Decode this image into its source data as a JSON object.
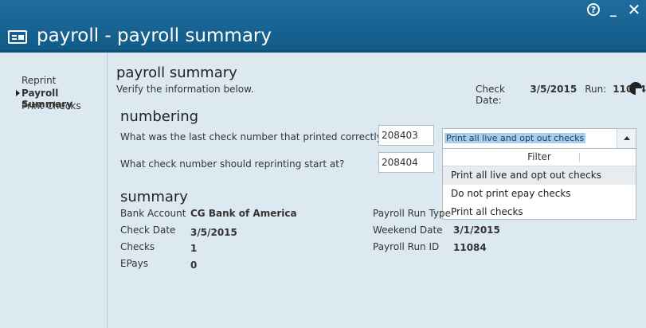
{
  "window": {
    "title": "payroll - payroll summary",
    "controls": {
      "help": "?",
      "minimize": "_",
      "close": "✕"
    }
  },
  "sidebar": {
    "items": [
      {
        "label": "Reprint"
      },
      {
        "label": "Payroll Summary",
        "active": true
      },
      {
        "label": "Print Checks"
      }
    ]
  },
  "main": {
    "title": "payroll summary",
    "subtitle": "Verify the information below.",
    "check_date_label": "Check Date:",
    "check_date_value": "3/5/2015",
    "run_label": "Run:",
    "run_value": "11084"
  },
  "numbering": {
    "heading": "numbering",
    "last_check_question": "What was the last check number that printed correctly?",
    "last_check_value": "208403",
    "reprint_start_question": "What check number should reprinting start at?",
    "reprint_start_value": "208404"
  },
  "print_select": {
    "selected": "Print all live and opt out checks",
    "filter_label": "Filter",
    "options": [
      "Print all live and opt out checks",
      "Do not print epay checks",
      "Print all checks"
    ]
  },
  "summary": {
    "heading": "summary",
    "bank_account_label": "Bank Account",
    "bank_account_value": "CG Bank of America",
    "check_date_label": "Check Date",
    "check_date_value": "3/5/2015",
    "checks_label": "Checks",
    "checks_value": "1",
    "epays_label": "EPays",
    "epays_value": "0",
    "payroll_run_type_label": "Payroll Run Type",
    "weekend_date_label": "Weekend Date",
    "weekend_date_value": "3/1/2015",
    "payroll_run_id_label": "Payroll Run ID",
    "payroll_run_id_value": "11084"
  },
  "colors": {
    "header": "#1a6496",
    "background": "#dde9f0",
    "selection": "#a9cdee"
  }
}
